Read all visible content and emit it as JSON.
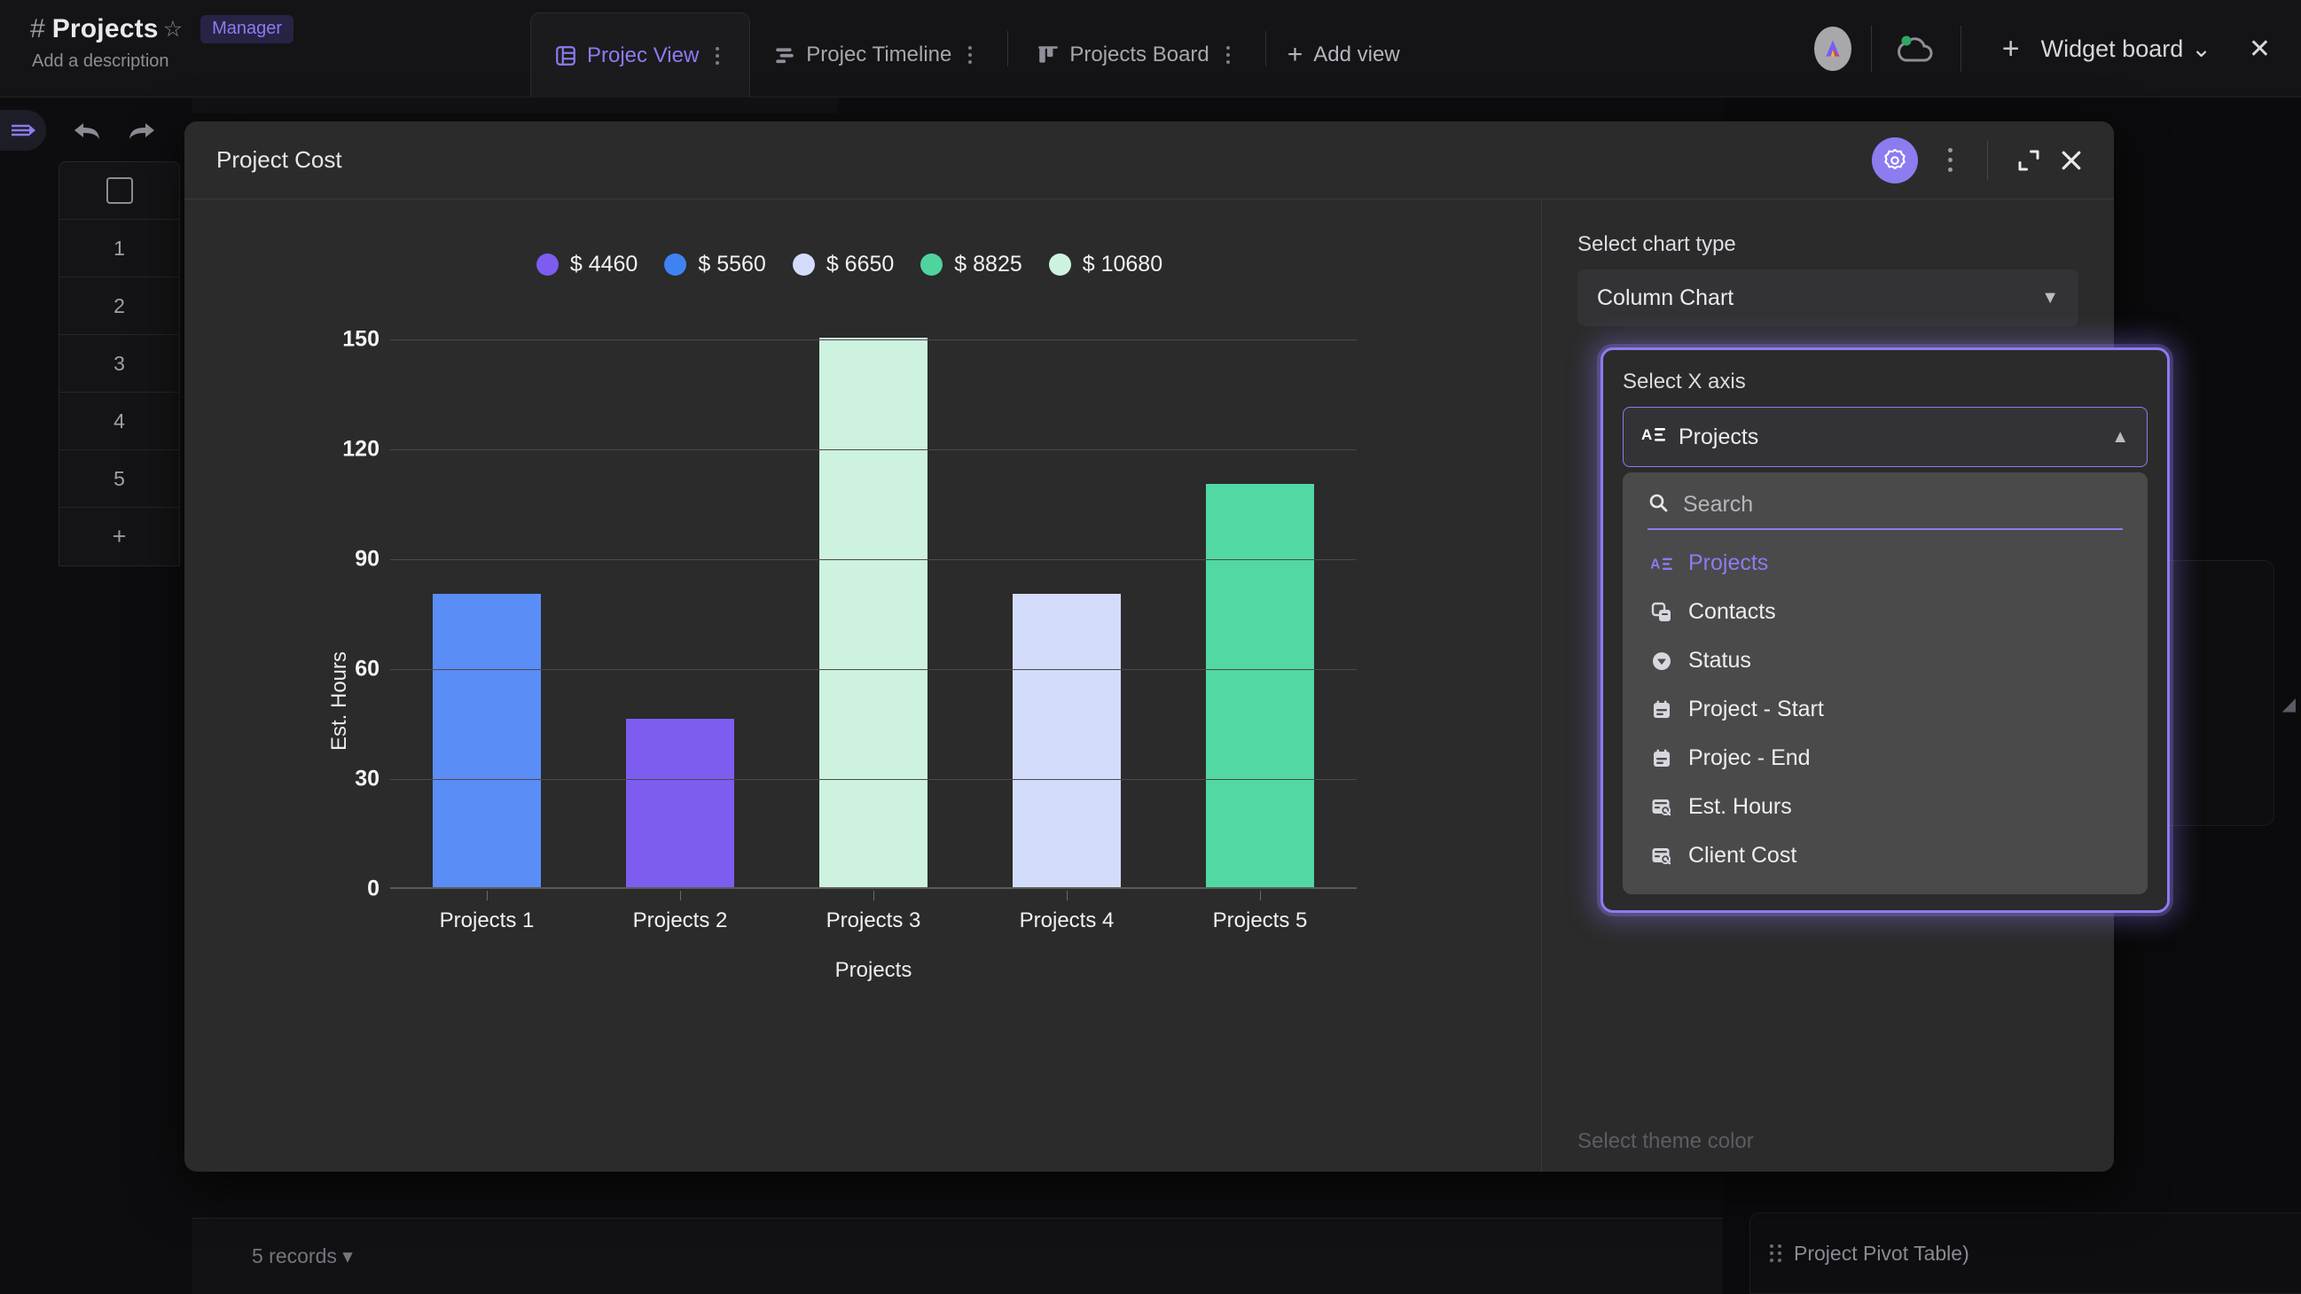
{
  "topbar": {
    "workspace_hash": "#",
    "workspace_name": "Projects",
    "star_icon": "star-icon",
    "role_badge": "Manager",
    "description": "Add a description",
    "tabs": [
      {
        "label": "Projec View",
        "icon": "grid-table-icon",
        "active": true
      },
      {
        "label": "Projec Timeline",
        "icon": "timeline-icon",
        "active": false
      },
      {
        "label": "Projects Board",
        "icon": "board-icon",
        "active": false
      }
    ],
    "add_view_label": "Add view",
    "add_view_icon": "plus-icon",
    "avatar_icon": "app-logo-avatar",
    "cloud_icon": "cloud-status-icon",
    "widget_plus_icon": "plus-icon",
    "widget_board_label": "Widget board",
    "widget_board_chevron": "chevron-down-icon",
    "close_icon": "close-icon"
  },
  "left_rail": {
    "collapse_icon": "collapse-sidebar-icon",
    "undo_icon": "undo-arrow-icon",
    "redo_icon": "redo-arrow-icon",
    "select_all_icon": "checkbox-icon",
    "rows": [
      "1",
      "2",
      "3",
      "4",
      "5"
    ],
    "add_row_icon": "plus-icon"
  },
  "bottom_bar": {
    "records_label": "5 records",
    "records_chevron": "caret-down-icon"
  },
  "right_panel": {
    "resize_handle_icon": "resize-handle-icon",
    "drag_icon": "drag-dots-icon",
    "pivot_card_label": "Project Pivot Table)"
  },
  "modal": {
    "title": "Project Cost",
    "gear_icon": "gear-icon",
    "kebab_icon": "more-vertical-icon",
    "expand_icon": "expand-icon",
    "close_icon": "close-icon"
  },
  "settings": {
    "chart_type_label": "Select chart type",
    "chart_type_value": "Column Chart",
    "chart_type_chevron": "chevron-down-icon",
    "x_axis_label": "Select X axis",
    "x_axis_value": "Projects",
    "x_axis_value_icon": "text-field-icon",
    "x_axis_chevron": "chevron-up-icon",
    "search_placeholder": "Search",
    "search_icon": "search-icon",
    "theme_color_label": "Select theme color",
    "options": [
      {
        "label": "Projects",
        "icon": "text-field-icon",
        "selected": true
      },
      {
        "label": "Contacts",
        "icon": "link-records-icon",
        "selected": false
      },
      {
        "label": "Status",
        "icon": "single-select-icon",
        "selected": false
      },
      {
        "label": "Project - Start",
        "icon": "calendar-icon",
        "selected": false
      },
      {
        "label": "Projec - End",
        "icon": "calendar-icon",
        "selected": false
      },
      {
        "label": "Est. Hours",
        "icon": "lookup-icon",
        "selected": false
      },
      {
        "label": "Client Cost",
        "icon": "lookup-icon",
        "selected": false
      }
    ]
  },
  "chart_data": {
    "type": "bar",
    "title": "Project Cost",
    "xlabel": "Projects",
    "ylabel": "Est. Hours",
    "categories": [
      "Projects 1",
      "Projects 2",
      "Projects 3",
      "Projects 4",
      "Projects 5"
    ],
    "values": [
      80,
      46,
      150,
      80,
      110
    ],
    "colors": [
      "#5b8df6",
      "#7d5cf0",
      "#cdf2df",
      "#d3ddfb",
      "#52d8a3"
    ],
    "yticks": [
      0,
      30,
      60,
      90,
      120,
      150
    ],
    "ylim": [
      0,
      150
    ],
    "grid": true,
    "legend_position": "top",
    "legend": [
      {
        "label": "$ 4460",
        "color": "#7d5cf0"
      },
      {
        "label": "$ 5560",
        "color": "#3f83f3"
      },
      {
        "label": "$ 6650",
        "color": "#d3ddfb"
      },
      {
        "label": "$ 8825",
        "color": "#4fd49e"
      },
      {
        "label": "$ 10680",
        "color": "#cdf2df"
      }
    ]
  }
}
